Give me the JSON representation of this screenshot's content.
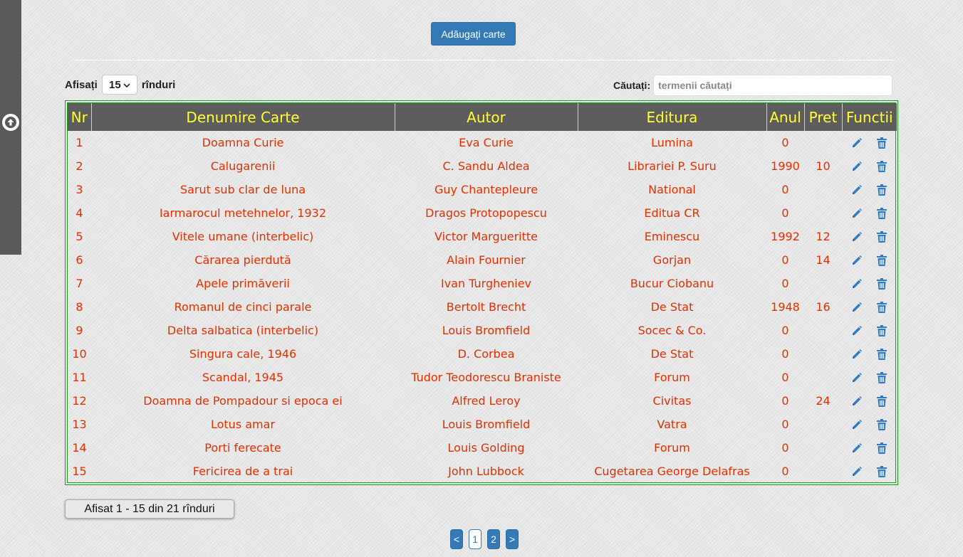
{
  "toolbar": {
    "add_label": "Adăugați carte"
  },
  "length_control": {
    "prefix": "Afisați",
    "value": "15",
    "suffix": "rînduri"
  },
  "search": {
    "label": "Căutați:",
    "placeholder": "termenii căutați",
    "value": ""
  },
  "table": {
    "columns": [
      "Nr",
      "Denumire Carte",
      "Autor",
      "Editura",
      "Anul",
      "Pret",
      "Functii"
    ],
    "rows": [
      {
        "nr": "1",
        "title": "Doamna Curie",
        "author": "Eva Curie",
        "publisher": "Lumina",
        "year": "0",
        "price": ""
      },
      {
        "nr": "2",
        "title": "Calugarenii",
        "author": "C. Sandu Aldea",
        "publisher": "Librariei P. Suru",
        "year": "1990",
        "price": "10"
      },
      {
        "nr": "3",
        "title": "Sarut sub clar de luna",
        "author": "Guy Chantepleure",
        "publisher": "National",
        "year": "0",
        "price": ""
      },
      {
        "nr": "4",
        "title": "Iarmarocul metehnelor, 1932",
        "author": "Dragos Protopopescu",
        "publisher": "Editua CR",
        "year": "0",
        "price": ""
      },
      {
        "nr": "5",
        "title": "Vitele umane (interbelic)",
        "author": "Victor Margueritte",
        "publisher": "Eminescu",
        "year": "1992",
        "price": "12"
      },
      {
        "nr": "6",
        "title": "Cărarea pierdută",
        "author": "Alain Fournier",
        "publisher": "Gorjan",
        "year": "0",
        "price": "14"
      },
      {
        "nr": "7",
        "title": "Apele primăverii",
        "author": "Ivan Turgheniev",
        "publisher": "Bucur Ciobanu",
        "year": "0",
        "price": ""
      },
      {
        "nr": "8",
        "title": "Romanul de cinci parale",
        "author": "Bertolt Brecht",
        "publisher": "De Stat",
        "year": "1948",
        "price": "16"
      },
      {
        "nr": "9",
        "title": "Delta salbatica (interbelic)",
        "author": "Louis Bromfield",
        "publisher": "Socec & Co.",
        "year": "0",
        "price": ""
      },
      {
        "nr": "10",
        "title": "Singura cale, 1946",
        "author": "D. Corbea",
        "publisher": "De Stat",
        "year": "0",
        "price": ""
      },
      {
        "nr": "11",
        "title": "Scandal, 1945",
        "author": "Tudor Teodorescu Braniste",
        "publisher": "Forum",
        "year": "0",
        "price": ""
      },
      {
        "nr": "12",
        "title": "Doamna de Pompadour si epoca ei",
        "author": "Alfred Leroy",
        "publisher": "Civitas",
        "year": "0",
        "price": "24"
      },
      {
        "nr": "13",
        "title": "Lotus amar",
        "author": "Louis Bromfield",
        "publisher": "Vatra",
        "year": "0",
        "price": ""
      },
      {
        "nr": "14",
        "title": "Porti ferecate",
        "author": "Louis Golding",
        "publisher": "Forum",
        "year": "0",
        "price": ""
      },
      {
        "nr": "15",
        "title": "Fericirea de a trai",
        "author": "John Lubbock",
        "publisher": "Cugetarea George Delafras",
        "year": "0",
        "price": ""
      }
    ]
  },
  "info": "Afisat 1 - 15 din 21 rînduri",
  "pagination": {
    "prev": "<",
    "pages": [
      "1",
      "2"
    ],
    "active": "1",
    "next": ">"
  },
  "colors": {
    "accent": "#337ab7",
    "header_bg": "#5d5d5d",
    "header_text": "#ffff33",
    "cell_text": "#e03000",
    "table_border": "#14a014",
    "sidebar": "#5a5a5a"
  },
  "icons": {
    "scroll_top": "arrow-up-circle-icon",
    "edit": "pencil-icon",
    "delete": "trash-icon"
  }
}
